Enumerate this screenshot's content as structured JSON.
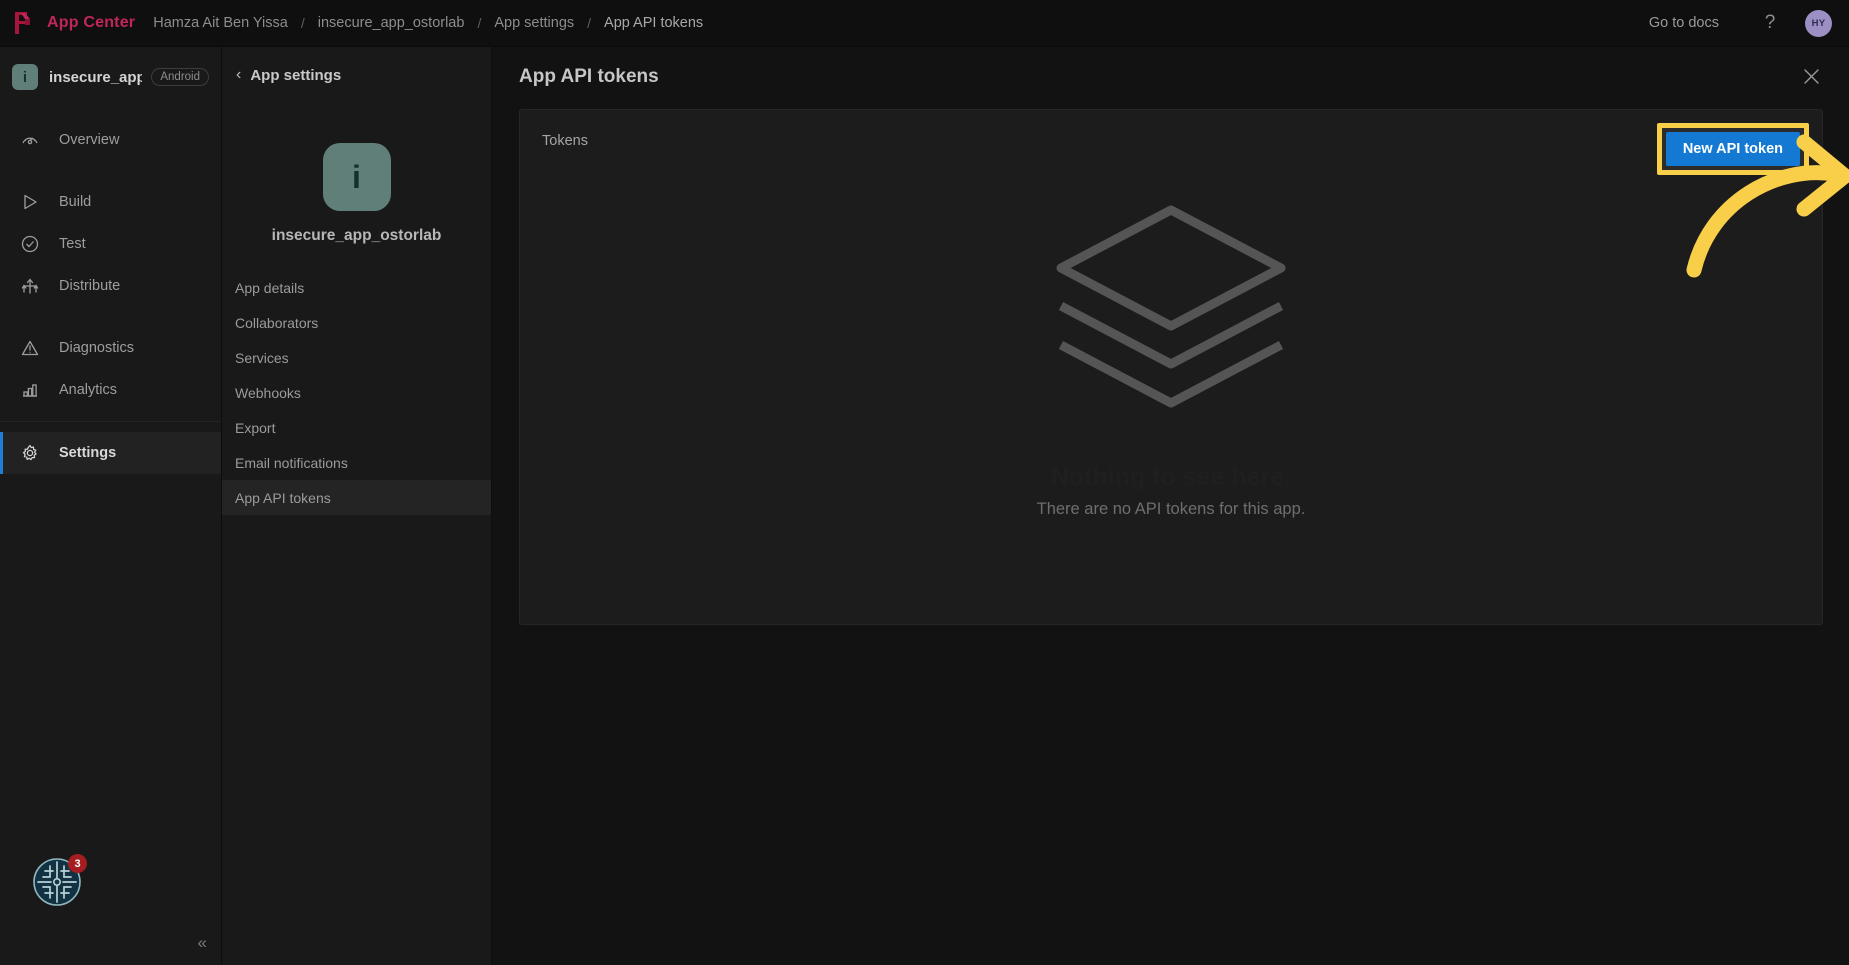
{
  "topbar": {
    "logo_icon": "app-center-logo-icon",
    "brand": "App Center",
    "breadcrumbs": [
      {
        "label": "Hamza Ait Ben Yissa"
      },
      {
        "label": "insecure_app_ostorlab"
      },
      {
        "label": "App settings"
      },
      {
        "label": "App API tokens"
      }
    ],
    "separator": "/",
    "go_to_docs": "Go to docs",
    "help_icon": "question-mark-icon",
    "avatar_initials": "HY"
  },
  "rail": {
    "app_icon_letter": "i",
    "app_name": "insecure_app_...",
    "platform_badge": "Android",
    "items": [
      {
        "label": "Overview",
        "icon": "gauge-icon",
        "active": false
      },
      {
        "label": "Build",
        "icon": "play-triangle-icon",
        "active": false
      },
      {
        "label": "Test",
        "icon": "check-circle-icon",
        "active": false
      },
      {
        "label": "Distribute",
        "icon": "distribute-arrows-icon",
        "active": false
      },
      {
        "label": "Diagnostics",
        "icon": "warning-triangle-icon",
        "active": false
      },
      {
        "label": "Analytics",
        "icon": "bar-chart-icon",
        "active": false
      },
      {
        "label": "Settings",
        "icon": "gear-icon",
        "active": true
      }
    ],
    "orb_icon": "circuit-orb-icon",
    "orb_badge_count": "3",
    "collapse_icon": "double-chevron-left-icon"
  },
  "subpanel": {
    "back_icon": "chevron-left-icon",
    "title": "App settings",
    "app_icon_letter": "i",
    "app_name": "insecure_app_ostorlab",
    "items": [
      {
        "label": "App details",
        "active": false
      },
      {
        "label": "Collaborators",
        "active": false
      },
      {
        "label": "Services",
        "active": false
      },
      {
        "label": "Webhooks",
        "active": false
      },
      {
        "label": "Export",
        "active": false
      },
      {
        "label": "Email notifications",
        "active": false
      },
      {
        "label": "App API tokens",
        "active": true
      }
    ]
  },
  "main": {
    "title": "App API tokens",
    "close_icon": "close-icon",
    "card": {
      "label": "Tokens",
      "new_token_button": "New API token",
      "empty_illustration_icon": "stacked-layers-icon",
      "empty_title": "Nothing to see here.",
      "empty_subtitle": "There are no API tokens for this app."
    }
  },
  "annotation": {
    "arrow_icon": "curved-arrow-icon",
    "highlight_color": "#F9CF4A",
    "target": "New API token"
  },
  "colors": {
    "brand_pink": "#c2255c",
    "accent_blue": "#1379D2",
    "active_rail_accent": "#1f7fd4",
    "app_icon_teal": "#5f7f78",
    "badge_red": "#a51d20",
    "highlight_yellow": "#F9CF4A"
  }
}
